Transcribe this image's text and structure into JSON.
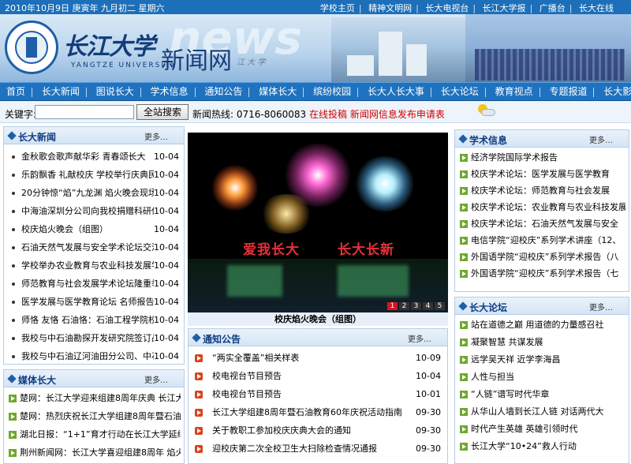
{
  "topbar": {
    "date": "2010年10月9日  庚寅年  九月初二  星期六",
    "links": [
      "学校主页",
      "精神文明网",
      "长大电视台",
      "长江大学报",
      "广播台",
      "长大在线"
    ]
  },
  "banner": {
    "university_cn": "长江大学",
    "site_name": "新闻网",
    "ghost_word": "news",
    "subtitle_en": "YANGTZE UNIVERSITY",
    "seal_text": "YANGTZE UNIVERSITY",
    "calligraphy_small": "江 大 学"
  },
  "nav": {
    "items": [
      "首页",
      "长大新闻",
      "图说长大",
      "学术信息",
      "通知公告",
      "媒体长大",
      "缤纷校园",
      "长大人长大事",
      "长大论坛",
      "教育视点",
      "专题报道",
      "长大影像"
    ]
  },
  "search": {
    "label": "关键字:",
    "placeholder": "",
    "button": "全站搜索",
    "hotline_label": "新闻热线:",
    "hotline_number": "0716-8060083",
    "online_submit": "在线投稿",
    "apply": "新闻网信息发布申请表"
  },
  "news": {
    "title": "长大新闻",
    "more": "更多…",
    "items": [
      {
        "t": "金秋歌会歌声献华彩 青春颂长大",
        "d": "10-04"
      },
      {
        "t": "乐韵飘香 礼献校庆 学校举行庆典民",
        "d": "10-04"
      },
      {
        "t": "20分钟惊“焰”九龙渊 焰火晚会现场",
        "d": "10-04"
      },
      {
        "t": "中海油深圳分公司向我校捐赠科研仪",
        "d": "10-04"
      },
      {
        "t": "校庆焰火晚会（组图）",
        "d": "10-04"
      },
      {
        "t": "石油天然气发展与安全学术论坛交流",
        "d": "10-04"
      },
      {
        "t": "学校举办农业教育与农业科技发展学",
        "d": "10-04"
      },
      {
        "t": "师范教育与社会发展学术论坛隆重举",
        "d": "10-04"
      },
      {
        "t": "医学发展与医学教育论坛 名师报告为",
        "d": "10-04"
      },
      {
        "t": "师恪 友恪 石油恪：石油工程学院校",
        "d": "10-04"
      },
      {
        "t": "我校与中石油勘探开发研究院签订战",
        "d": "10-04"
      },
      {
        "t": "我校与中石油辽河油田分公司、中石",
        "d": "10-04"
      }
    ]
  },
  "media": {
    "title": "媒体长大",
    "more": "更多…",
    "items": [
      {
        "t": "楚网：长江大学迎来组建8周年庆典 长江大"
      },
      {
        "t": "楚网：热烈庆祝长江大学组建8周年暨石油教"
      },
      {
        "t": "湖北日报：“1+1”育才行动在长江大学延续"
      },
      {
        "t": "荆州新闻网：长江大学喜迎组建8周年 焰火"
      }
    ]
  },
  "feature": {
    "slogan_left": "爱我长大",
    "slogan_right": "长大长新",
    "pages": [
      "1",
      "2",
      "3",
      "4",
      "5"
    ],
    "active_page": "1",
    "caption": "校庆焰火晚会（组图）"
  },
  "notice": {
    "title": "通知公告",
    "more": "更多…",
    "items": [
      {
        "t": "“两实全覆盖”相关样表",
        "d": "10-09"
      },
      {
        "t": "校电视台节目预告",
        "d": "10-04"
      },
      {
        "t": "校电视台节目预告",
        "d": "10-01"
      },
      {
        "t": "长江大学组建8周年暨石油教育60年庆祝活动指南",
        "d": "09-30"
      },
      {
        "t": "关于教职工参加校庆庆典大会的通知",
        "d": "09-30"
      },
      {
        "t": "迎校庆第二次全校卫生大扫除检查情况通报",
        "d": "09-30"
      }
    ]
  },
  "academic": {
    "title": "学术信息",
    "more": "更多…",
    "items": [
      {
        "t": "经济学院国际学术报告"
      },
      {
        "t": "校庆学术论坛：医学发展与医学教育"
      },
      {
        "t": "校庆学术论坛：师范教育与社会发展"
      },
      {
        "t": "校庆学术论坛：农业教育与农业科技发展"
      },
      {
        "t": "校庆学术论坛：石油天然气发展与安全"
      },
      {
        "t": "电信学院“迎校庆”系列学术讲座（12、"
      },
      {
        "t": "外国语学院“迎校庆”系列学术报告（八"
      },
      {
        "t": "外国语学院“迎校庆”系列学术报告（七"
      }
    ]
  },
  "forum": {
    "title": "长大论坛",
    "more": "更多…",
    "items": [
      {
        "t": "站在道德之巅 用道德的力量感召社"
      },
      {
        "t": "凝聚智慧 共谋发展"
      },
      {
        "t": "远学吴天祥 近学李海昌"
      },
      {
        "t": "人性与担当"
      },
      {
        "t": "“人链”谱写时代华章"
      },
      {
        "t": "从华山人墙到长江人链 对话两代大"
      },
      {
        "t": "时代产生英雄  英雄引领时代"
      },
      {
        "t": "长江大学“10•24”救人行动"
      }
    ]
  },
  "colors": {
    "nav_blue": "#1f72bf",
    "title_blue": "#0f3c80",
    "accent_red": "#d20000",
    "arrow_green": "#6ea82f"
  }
}
